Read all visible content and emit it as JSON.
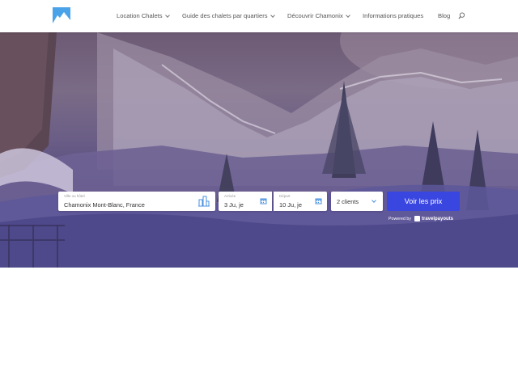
{
  "nav": {
    "items": [
      {
        "label": "Location Chalets",
        "has_dropdown": true
      },
      {
        "label": "Guide des chalets par quartiers",
        "has_dropdown": true
      },
      {
        "label": "Découvrir Chamonix",
        "has_dropdown": true
      },
      {
        "label": "Informations pratiques",
        "has_dropdown": false
      },
      {
        "label": "Blog",
        "has_dropdown": false
      }
    ]
  },
  "search_form": {
    "city_label": "Ville ou hôtel",
    "city_value": "Chamonix Mont-Blanc, France",
    "arrival_label": "Arrivée",
    "arrival_value": "3 Ju, je",
    "departure_label": "Départ",
    "departure_value": "10 Ju, je",
    "guests_value": "2 clients",
    "submit_label": "Voir les prix",
    "powered_by": "Powered by",
    "provider": "travelpayouts"
  },
  "colors": {
    "accent": "#3a46e0",
    "icon_blue": "#4a90e2",
    "hero_overlay": "#4f4880"
  }
}
